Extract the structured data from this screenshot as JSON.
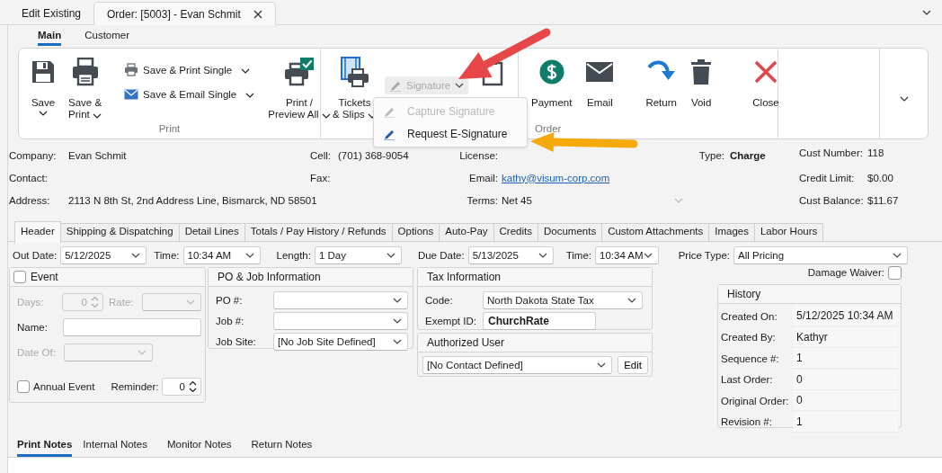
{
  "document_tabs": [
    {
      "label": "Edit Existing",
      "selected": false,
      "closable": false
    },
    {
      "label": "Order: [5003] - Evan Schmit",
      "selected": true,
      "closable": true
    }
  ],
  "ribbon_tabs": [
    {
      "label": "Main",
      "selected": true
    },
    {
      "label": "Customer",
      "selected": false
    }
  ],
  "ribbon_groups": [
    {
      "label": "Print",
      "items": [
        {
          "kind": "save",
          "lines": [
            "Save"
          ],
          "dropdown": true
        },
        {
          "kind": "print",
          "lines": [
            "Save &",
            "Print"
          ],
          "dropdown": true
        },
        {
          "kind": "separator"
        },
        {
          "kind": "stack",
          "entries": [
            {
              "kind": "print",
              "label": "Save & Print Single",
              "dropdown": true
            },
            {
              "kind": "email",
              "label": "Save & Email Single",
              "dropdown": true
            }
          ]
        },
        {
          "kind": "print-all",
          "lines": [
            "Print /",
            "Preview All"
          ],
          "dropdown": true
        }
      ]
    },
    {
      "items": [
        {
          "kind": "tickets",
          "lines": [
            "Tickets",
            "& Slips"
          ],
          "dropdown": true
        },
        {
          "kind": "signature",
          "label": "Signature",
          "dropdown": true,
          "disabled": true
        },
        {
          "kind": "copy",
          "dropdown": false
        }
      ]
    },
    {
      "label": "Order",
      "items": [
        {
          "kind": "payment",
          "lines": [
            "Payment"
          ],
          "dropdown": false
        },
        {
          "kind": "mail",
          "lines": [
            "Email"
          ],
          "dropdown": false
        },
        {
          "kind": "separator"
        },
        {
          "kind": "return",
          "lines": [
            "Return"
          ],
          "dropdown": false
        },
        {
          "kind": "void",
          "lines": [
            "Void"
          ],
          "dropdown": false
        },
        {
          "kind": "separator"
        },
        {
          "kind": "close",
          "lines": [
            "Close"
          ],
          "dropdown": false
        }
      ]
    }
  ],
  "signature_menu": [
    {
      "label": "Capture Signature",
      "disabled": true
    },
    {
      "label": "Request E-Signature",
      "disabled": false
    }
  ],
  "customer": {
    "company": {
      "label": "Company:",
      "value": "Evan Schmit"
    },
    "contact": {
      "label": "Contact:"
    },
    "address": {
      "label": "Address:",
      "value": "2113 N 8th St, 2nd Address Line, Bismarck, ND 58501"
    },
    "cell": {
      "label": "Cell:",
      "value": "(701) 368-9054"
    },
    "fax": {
      "label": "Fax:"
    },
    "license": {
      "label": "License:"
    },
    "email": {
      "label": "Email:",
      "value": "kathy@visum-corp.com"
    },
    "terms": {
      "label": "Terms:",
      "value": "Net 45"
    },
    "type": {
      "label": "Type:",
      "value": "Charge"
    }
  },
  "account": [
    {
      "label": "Cust Number:",
      "value": "118"
    },
    {
      "label": "Credit Limit:",
      "value": "$0.00"
    },
    {
      "label": "Cust Balance:",
      "value": "$11.67"
    }
  ],
  "detail_tabs": [
    {
      "label": "Header",
      "selected": true
    },
    {
      "label": "Shipping & Dispatching",
      "selected": false
    },
    {
      "label": "Detail Lines",
      "selected": false
    },
    {
      "label": "Totals / Pay History / Refunds",
      "selected": false
    },
    {
      "label": "Options",
      "selected": false
    },
    {
      "label": "Auto-Pay",
      "selected": false
    },
    {
      "label": "Credits",
      "selected": false
    },
    {
      "label": "Documents",
      "selected": false
    },
    {
      "label": "Custom Attachments",
      "selected": false
    },
    {
      "label": "Images",
      "selected": false
    },
    {
      "label": "Labor Hours",
      "selected": false
    }
  ],
  "schedule": [
    {
      "label": "Out Date:",
      "value": "5/12/2025"
    },
    {
      "label": "Time:",
      "value": "10:34 AM"
    },
    {
      "label": "Length:",
      "value": "1 Day"
    },
    {
      "label": "Due Date:",
      "value": "5/13/2025"
    },
    {
      "label": "Time:",
      "value": "10:34 AM"
    }
  ],
  "price_type": {
    "label": "Price Type:",
    "value": "All Pricing"
  },
  "damage_waiver": {
    "label": "Damage Waiver:",
    "checked": false
  },
  "event": {
    "label": "Event",
    "checked": false,
    "days": {
      "label": "Days:",
      "value": "0",
      "disabled": true
    },
    "rate": {
      "label": "Rate:",
      "disabled": true
    },
    "name": {
      "label": "Name:"
    },
    "date_of": {
      "label": "Date Of:",
      "disabled": true
    },
    "annual": {
      "label": "Annual Event",
      "checked": false
    },
    "reminder": {
      "label": "Reminder:",
      "value": "0"
    }
  },
  "po_job": {
    "title": "PO & Job Information",
    "fields": [
      {
        "label": "PO #:"
      },
      {
        "label": "Job #:"
      },
      {
        "label": "Job Site:",
        "value": "[No Job Site Defined]"
      }
    ]
  },
  "tax": {
    "title": "Tax Information",
    "code": {
      "label": "Code:",
      "value": "North Dakota State Tax"
    },
    "exempt_id": {
      "label": "Exempt ID:",
      "value": "ChurchRate"
    }
  },
  "authorized_user": {
    "title": "Authorized User",
    "value": "[No Contact Defined]",
    "button": "Edit"
  },
  "history": {
    "title": "History",
    "rows": [
      {
        "label": "Created On:",
        "value": "5/12/2025 10:34 AM"
      },
      {
        "label": "Created By:",
        "value": "Kathyr"
      },
      {
        "label": "Sequence #:",
        "value": "1"
      },
      {
        "label": "Last Order:",
        "value": "0"
      },
      {
        "label": "Original Order:",
        "value": "0"
      },
      {
        "label": "Revision #:",
        "value": "1"
      }
    ]
  },
  "notes_tabs": [
    {
      "label": "Print Notes",
      "selected": true
    },
    {
      "label": "Internal Notes",
      "selected": false
    },
    {
      "label": "Monitor Notes",
      "selected": false
    },
    {
      "label": "Return Notes",
      "selected": false
    }
  ],
  "callout_arrows": [
    {
      "color": "#e8474a"
    },
    {
      "color": "#f5a90a"
    }
  ]
}
